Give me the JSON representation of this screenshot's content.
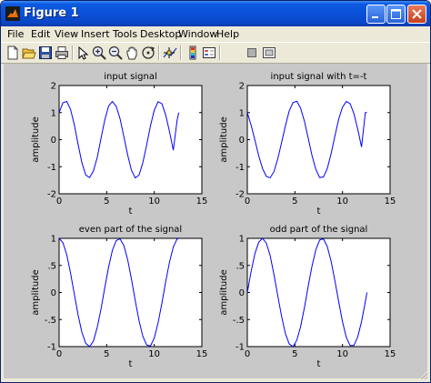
{
  "window": {
    "title": "Figure 1",
    "app_icon": "matlab-icon",
    "controls": [
      "minimize-icon",
      "maximize-icon",
      "close-icon"
    ]
  },
  "menubar": {
    "items": [
      {
        "label": "File",
        "name": "menu-file"
      },
      {
        "label": "Edit",
        "name": "menu-edit"
      },
      {
        "label": "View",
        "name": "menu-view"
      },
      {
        "label": "Insert",
        "name": "menu-insert"
      },
      {
        "label": "Tools",
        "name": "menu-tools"
      },
      {
        "label": "Desktop",
        "name": "menu-desktop"
      },
      {
        "label": "Window",
        "name": "menu-window"
      },
      {
        "label": "Help",
        "name": "menu-help"
      }
    ]
  },
  "toolbar": {
    "icons": [
      "new-figure-icon",
      "open-file-icon",
      "save-icon",
      "print-icon",
      "edit-plot-icon",
      "zoom-in-icon",
      "zoom-out-icon",
      "pan-icon",
      "rotate-3d-icon",
      "data-cursor-icon",
      "colorbar-icon",
      "legend-icon",
      "hide-plot-tools-icon",
      "show-plot-tools-icon"
    ]
  },
  "colors": {
    "line": "#0000ff",
    "figure_background": "#c8c8c8",
    "axes_background": "#ffffff"
  },
  "chart_data": [
    {
      "type": "line",
      "title": "input signal",
      "xlabel": "t",
      "ylabel": "amplitude",
      "xlim": [
        0,
        15
      ],
      "ylim": [
        -2,
        2
      ],
      "xticks": [
        0,
        5,
        10,
        15
      ],
      "yticks": [
        -2,
        -1,
        0,
        1,
        2
      ],
      "grid": false,
      "series": [
        {
          "values": {
            "x": [
              0,
              0.4,
              0.8,
              1.2,
              1.6,
              2.0,
              2.4,
              2.8,
              3.2,
              3.6,
              4.0,
              4.4,
              4.8,
              5.2,
              5.6,
              6.0,
              6.4,
              6.8,
              7.2,
              7.6,
              8.0,
              8.4,
              8.8,
              9.2,
              9.6,
              10.0,
              10.4,
              10.8,
              11.2,
              11.6,
              12.0,
              12.4,
              12.57
            ],
            "y": [
              1.0,
              1.36,
              1.41,
              1.12,
              0.55,
              -0.18,
              -0.86,
              -1.31,
              -1.4,
              -1.16,
              -0.67,
              0.04,
              0.73,
              1.24,
              1.41,
              1.23,
              0.78,
              0.12,
              -0.56,
              -1.13,
              -1.41,
              -1.31,
              -0.85,
              -0.2,
              0.51,
              1.09,
              1.4,
              1.33,
              0.91,
              0.3,
              -0.39,
              0.72,
              1.0
            ]
          }
        }
      ]
    },
    {
      "type": "line",
      "title": "input signal with t=-t",
      "xlabel": "t",
      "ylabel": "amplitude",
      "xlim": [
        0,
        15
      ],
      "ylim": [
        -2,
        2
      ],
      "xticks": [
        0,
        5,
        10,
        15
      ],
      "yticks": [
        -2,
        -1,
        0,
        1,
        2
      ],
      "grid": false,
      "series": [
        {
          "values": {
            "x": [
              0,
              0.4,
              0.8,
              1.2,
              1.6,
              2.0,
              2.4,
              2.8,
              3.2,
              3.6,
              4.0,
              4.4,
              4.8,
              5.2,
              5.6,
              6.0,
              6.4,
              6.8,
              7.2,
              7.6,
              8.0,
              8.4,
              8.8,
              9.2,
              9.6,
              10.0,
              10.4,
              10.8,
              11.2,
              11.6,
              12.0,
              12.4,
              12.57
            ],
            "y": [
              1.0,
              0.53,
              -0.02,
              -0.6,
              -1.07,
              -1.36,
              -1.41,
              -1.18,
              -0.71,
              -0.11,
              0.51,
              1.06,
              1.37,
              1.42,
              1.16,
              0.68,
              0.05,
              -0.59,
              -1.1,
              -1.4,
              -1.38,
              -1.07,
              -0.52,
              0.13,
              0.76,
              1.2,
              1.41,
              1.33,
              0.96,
              0.39,
              -0.27,
              1.0,
              1.0
            ]
          }
        }
      ]
    },
    {
      "type": "line",
      "title": "even  part of the signal",
      "xlabel": "t",
      "ylabel": "amplitude",
      "xlim": [
        0,
        15
      ],
      "ylim": [
        -1,
        1
      ],
      "xticks": [
        0,
        5,
        10,
        15
      ],
      "yticks": [
        -1,
        -0.5,
        0,
        0.5,
        1
      ],
      "grid": false,
      "series": [
        {
          "values": {
            "x": [
              0,
              0.4,
              0.8,
              1.2,
              1.6,
              2.0,
              2.4,
              2.8,
              3.2,
              3.6,
              4.0,
              4.4,
              4.8,
              5.2,
              5.6,
              6.0,
              6.4,
              6.8,
              7.2,
              7.6,
              8.0,
              8.4,
              8.8,
              9.2,
              9.6,
              10.0,
              10.4,
              10.8,
              11.2,
              11.6,
              12.0,
              12.4,
              12.57
            ],
            "y": [
              1.0,
              0.92,
              0.7,
              0.36,
              -0.03,
              -0.42,
              -0.74,
              -0.94,
              -1.0,
              -0.9,
              -0.65,
              -0.31,
              0.09,
              0.47,
              0.78,
              0.96,
              0.99,
              0.87,
              0.61,
              0.25,
              -0.15,
              -0.52,
              -0.81,
              -0.97,
              -0.99,
              -0.84,
              -0.56,
              -0.2,
              0.2,
              0.56,
              0.84,
              0.99,
              1.0
            ]
          }
        }
      ]
    },
    {
      "type": "line",
      "title": "odd  part of the signal",
      "xlabel": "t",
      "ylabel": "amplitude",
      "xlim": [
        0,
        15
      ],
      "ylim": [
        -1,
        1
      ],
      "xticks": [
        0,
        5,
        10,
        15
      ],
      "yticks": [
        -1,
        -0.5,
        0,
        0.5,
        1
      ],
      "grid": false,
      "series": [
        {
          "values": {
            "x": [
              0,
              0.4,
              0.8,
              1.2,
              1.6,
              2.0,
              2.4,
              2.8,
              3.2,
              3.6,
              4.0,
              4.4,
              4.8,
              5.2,
              5.6,
              6.0,
              6.4,
              6.8,
              7.2,
              7.6,
              8.0,
              8.4,
              8.8,
              9.2,
              9.6,
              10.0,
              10.4,
              10.8,
              11.2,
              11.6,
              12.0,
              12.4,
              12.57
            ],
            "y": [
              0,
              0.39,
              0.72,
              0.93,
              1.0,
              0.91,
              0.68,
              0.33,
              -0.06,
              -0.44,
              -0.76,
              -0.95,
              -1.0,
              -0.88,
              -0.63,
              -0.28,
              0.12,
              0.49,
              0.79,
              0.97,
              0.99,
              0.85,
              0.58,
              0.22,
              -0.17,
              -0.54,
              -0.83,
              -0.98,
              -0.98,
              -0.82,
              -0.54,
              -0.17,
              0
            ]
          }
        }
      ]
    }
  ]
}
